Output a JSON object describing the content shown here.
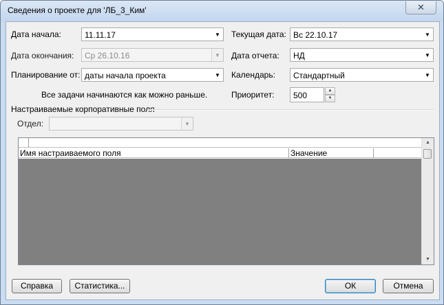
{
  "window": {
    "title": "Сведения о проекте для 'ЛБ_3_Ким'",
    "close_glyph": "✕"
  },
  "form": {
    "start_date": {
      "label": "Дата начала:",
      "value": "11.11.17"
    },
    "finish_date": {
      "label": "Дата окончания:",
      "value": "Ср 26.10.16"
    },
    "schedule_from": {
      "label": "Планирование от:",
      "value": "даты начала проекта"
    },
    "current_date": {
      "label": "Текущая дата:",
      "value": "Вс 22.10.17"
    },
    "status_date": {
      "label": "Дата отчета:",
      "value": "НД"
    },
    "calendar": {
      "label": "Календарь:",
      "value": "Стандартный"
    },
    "priority": {
      "label": "Приоритет:",
      "value": "500"
    },
    "schedule_note": "Все задачи начинаются как можно раньше."
  },
  "custom_fields": {
    "group_title": "Настраиваемые корпоративные поля",
    "department_label": "Отдел:",
    "department_value": "",
    "columns": [
      "Имя настраиваемого поля",
      "Значение"
    ]
  },
  "buttons": {
    "help": "Справка",
    "statistics": "Статистика...",
    "ok": "ОК",
    "cancel": "Отмена"
  },
  "icons": {
    "dropdown": "chevron-down-icon",
    "spin_up": "up-arrow-icon",
    "spin_down": "down-arrow-icon",
    "close": "close-icon"
  }
}
